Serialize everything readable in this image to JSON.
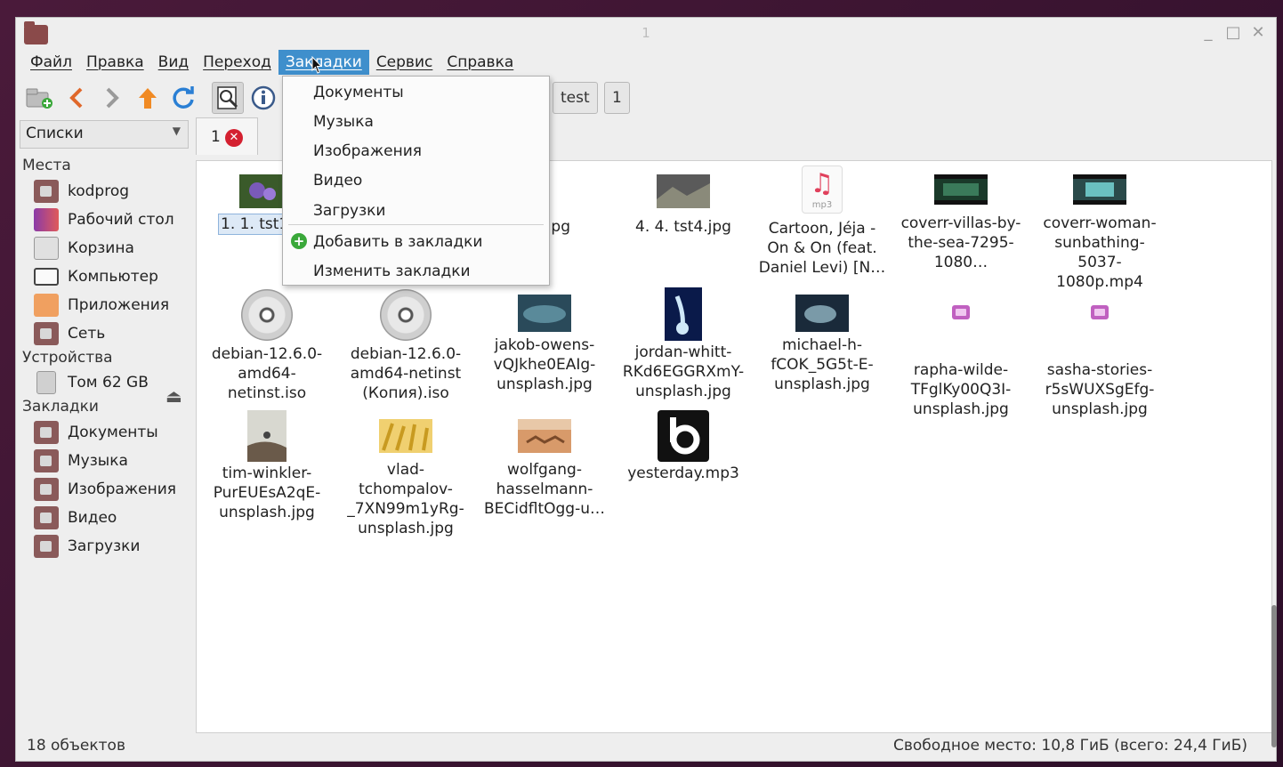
{
  "window": {
    "title": "1",
    "minimize": "_",
    "maximize": "□",
    "close": "✕"
  },
  "menubar": [
    "Файл",
    "Правка",
    "Вид",
    "Переход",
    "Закладки",
    "Сервис",
    "Справка"
  ],
  "toolbar": {
    "path_buttons": [
      "test",
      "1"
    ]
  },
  "sidebar": {
    "mode_select": "Списки",
    "sections": {
      "places": "Места",
      "devices": "Устройства",
      "bookmarks": "Закладки"
    },
    "places": [
      "kodprog",
      "Рабочий стол",
      "Корзина",
      "Компьютер",
      "Приложения",
      "Сеть"
    ],
    "devices": [
      "Том 62 GB"
    ],
    "bookmarks": [
      "Документы",
      "Музыка",
      "Изображения",
      "Видео",
      "Загрузки"
    ]
  },
  "tab": {
    "label": "1",
    "close": "✕"
  },
  "files": [
    {
      "name": "1. 1. tst1",
      "type": "image"
    },
    {
      "name": "3.jpg",
      "type": "image"
    },
    {
      "name": "4. 4. tst4.jpg",
      "type": "image"
    },
    {
      "name": "Cartoon, Jéja - On & On (feat. Daniel Levi) [N…",
      "type": "audio"
    },
    {
      "name": "coverr-villas-by-the-sea-7295-1080…",
      "type": "video"
    },
    {
      "name": "coverr-woman-sunbathing-5037-1080p.mp4",
      "type": "video"
    },
    {
      "name": "debian-12.6.0-amd64-netinst.iso",
      "type": "disc"
    },
    {
      "name": "debian-12.6.0-amd64-netinst (Копия).iso",
      "type": "disc"
    },
    {
      "name": "jakob-owens-vQJkhe0EAIg-unsplash.jpg",
      "type": "image"
    },
    {
      "name": "jordan-whitt-RKd6EGGRXmY-unsplash.jpg",
      "type": "image"
    },
    {
      "name": "michael-h-fCOK_5G5t-E-unsplash.jpg",
      "type": "image"
    },
    {
      "name": "rapha-wilde-TFglKy00Q3I-unsplash.jpg",
      "type": "image-placeholder"
    },
    {
      "name": "sasha-stories-r5sWUXSgEfg-unsplash.jpg",
      "type": "image-placeholder"
    },
    {
      "name": "tim-winkler-PurEUEsA2qE-unsplash.jpg",
      "type": "image"
    },
    {
      "name": "vlad-tchompalov-_7XN99m1yRg-unsplash.jpg",
      "type": "image"
    },
    {
      "name": "wolfgang-hasselmann-BECidfltOgg-u…",
      "type": "image"
    },
    {
      "name": "yesterday.mp3",
      "type": "audio"
    }
  ],
  "mp3_label": "mp3",
  "bookmarks_menu": {
    "items": [
      "Документы",
      "Музыка",
      "Изображения",
      "Видео",
      "Загрузки"
    ],
    "add": "Добавить в закладки",
    "edit": "Изменить закладки"
  },
  "status": {
    "count": "18 объектов",
    "free": "Свободное место: 10,8 ГиБ (всего: 24,4 ГиБ)"
  }
}
